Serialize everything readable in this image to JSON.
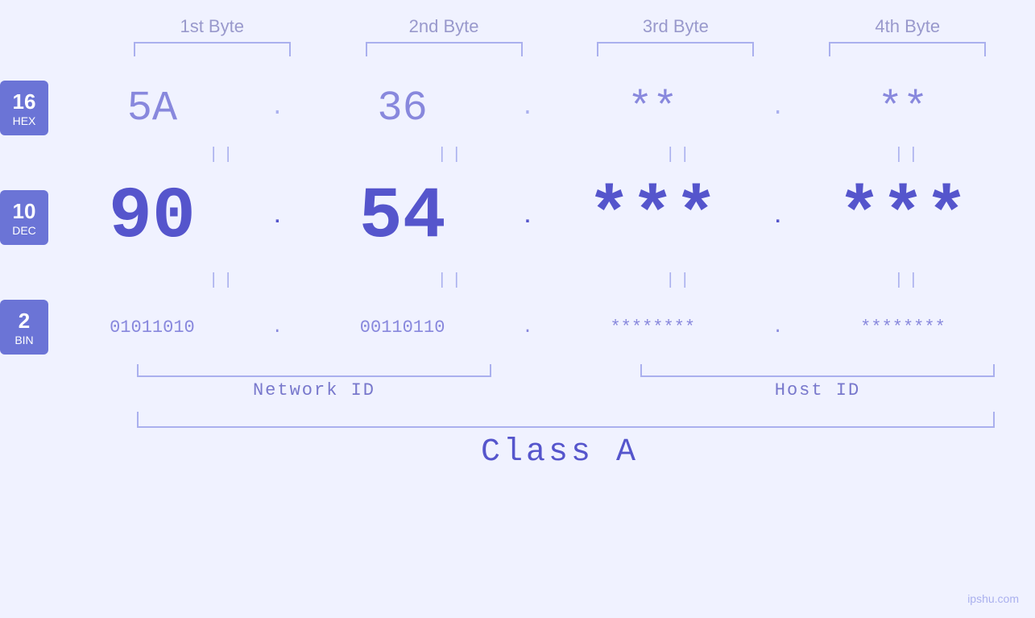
{
  "header": {
    "byte_labels": [
      "1st Byte",
      "2nd Byte",
      "3rd Byte",
      "4th Byte"
    ]
  },
  "badges": [
    {
      "number": "16",
      "base": "HEX"
    },
    {
      "number": "10",
      "base": "DEC"
    },
    {
      "number": "2",
      "base": "BIN"
    }
  ],
  "bytes": {
    "hex": [
      "5A",
      "36",
      "**",
      "**"
    ],
    "dec": [
      "90",
      "54",
      "***",
      "***"
    ],
    "bin": [
      "01011010",
      "00110110",
      "********",
      "********"
    ]
  },
  "separators": {
    "dot_small": ".",
    "dot_large": ".",
    "dot_bin": ".",
    "equals": "||"
  },
  "labels": {
    "network_id": "Network ID",
    "host_id": "Host ID",
    "class": "Class A"
  },
  "watermark": "ipshu.com"
}
